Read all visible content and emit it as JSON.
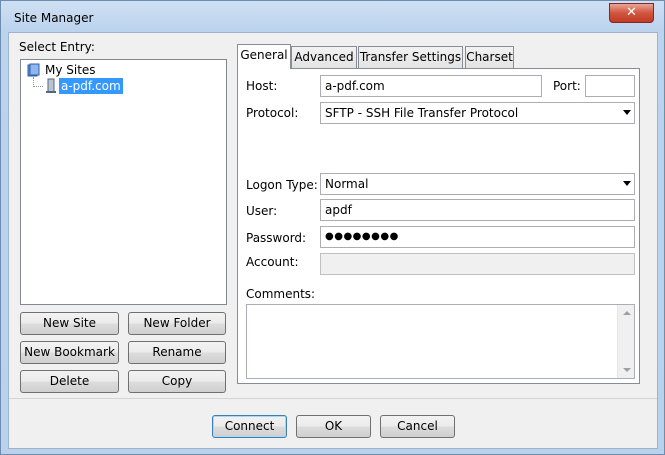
{
  "window": {
    "title": "Site Manager",
    "close_glyph": "✕"
  },
  "tree": {
    "label": "Select Entry:",
    "root": {
      "label": "My Sites",
      "icon": "folder-icon"
    },
    "items": [
      {
        "label": "a-pdf.com",
        "icon": "server-icon",
        "selected": true
      }
    ]
  },
  "left_buttons": {
    "new_site": "New Site",
    "new_folder": "New Folder",
    "new_bookmark": "New Bookmark",
    "rename": "Rename",
    "delete": "Delete",
    "copy": "Copy"
  },
  "tabs": [
    {
      "label": "General",
      "active": true
    },
    {
      "label": "Advanced",
      "active": false
    },
    {
      "label": "Transfer Settings",
      "active": false
    },
    {
      "label": "Charset",
      "active": false
    }
  ],
  "form": {
    "host_label": "Host:",
    "host_value": "a-pdf.com",
    "port_label": "Port:",
    "port_value": "",
    "protocol_label": "Protocol:",
    "protocol_value": "SFTP - SSH File Transfer Protocol",
    "logon_type_label": "Logon Type:",
    "logon_type_value": "Normal",
    "user_label": "User:",
    "user_value": "apdf",
    "password_label": "Password:",
    "password_value": "●●●●●●●●",
    "account_label": "Account:",
    "account_value": "",
    "comments_label": "Comments:",
    "comments_value": ""
  },
  "footer": {
    "connect": "Connect",
    "ok": "OK",
    "cancel": "Cancel"
  },
  "colors": {
    "selection": "#3399ff",
    "accent": "#3c7fb1",
    "close_red": "#c23b22"
  }
}
